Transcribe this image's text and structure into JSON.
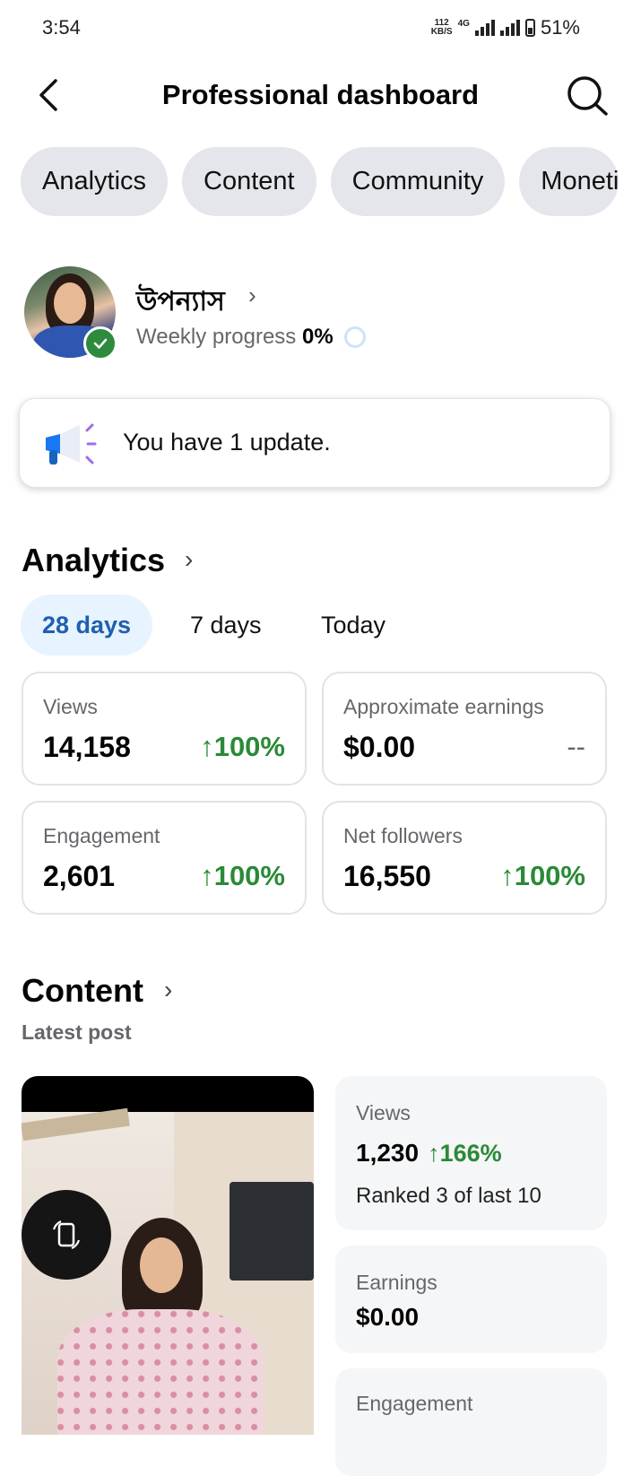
{
  "status_bar": {
    "time": "3:54",
    "net_speed_value": "112",
    "net_speed_unit": "KB/S",
    "network_type": "4G",
    "battery": "51%"
  },
  "header": {
    "title": "Professional dashboard",
    "back_icon": "arrow-left-icon",
    "search_icon": "search-icon"
  },
  "tabs": [
    {
      "label": "Analytics"
    },
    {
      "label": "Content"
    },
    {
      "label": "Community"
    },
    {
      "label": "Moneti"
    }
  ],
  "profile": {
    "name": "উপন্যাস",
    "weekly_progress_label": "Weekly progress",
    "weekly_progress_value": "0%",
    "verified": true
  },
  "update_banner": {
    "text": "You have 1 update.",
    "icon": "megaphone-icon"
  },
  "analytics": {
    "title": "Analytics",
    "ranges": [
      {
        "label": "28 days",
        "active": true
      },
      {
        "label": "7 days",
        "active": false
      },
      {
        "label": "Today",
        "active": false
      }
    ],
    "metrics": [
      {
        "label": "Views",
        "value": "14,158",
        "change": "↑100%"
      },
      {
        "label": "Approximate earnings",
        "value": "$0.00",
        "change": "--"
      },
      {
        "label": "Engagement",
        "value": "2,601",
        "change": "↑100%"
      },
      {
        "label": "Net followers",
        "value": "16,550",
        "change": "↑100%"
      }
    ]
  },
  "content": {
    "title": "Content",
    "subtitle": "Latest post",
    "views_label": "Views",
    "views_value": "1,230",
    "views_change": "↑166%",
    "views_rank": "Ranked 3 of last 10",
    "earnings_label": "Earnings",
    "earnings_value": "$0.00",
    "engagement_label": "Engagement"
  },
  "colors": {
    "accent_blue": "#1f5fae",
    "positive_green": "#2a8a37",
    "chip_gray": "#e4e6eb",
    "verified_green": "#2e8b3d"
  }
}
